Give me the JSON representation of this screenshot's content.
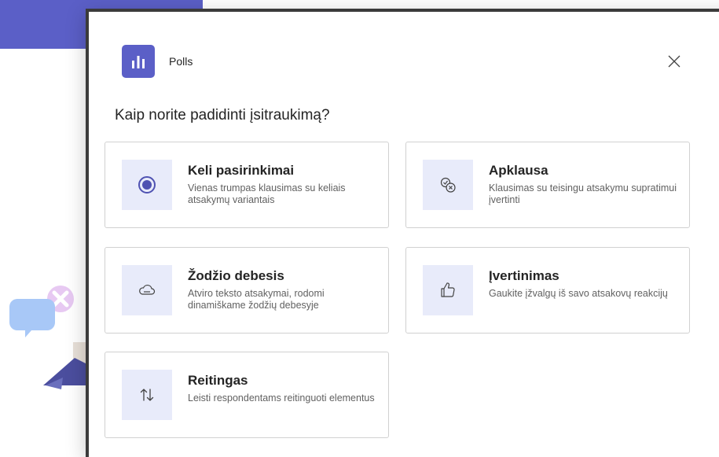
{
  "app": {
    "name": "Polls",
    "icon": "bar-chart-icon",
    "accent": "#5b5fc7"
  },
  "close": {
    "icon": "close-icon"
  },
  "question": "Kaip norite padidinti įsitraukimą?",
  "options": [
    {
      "title": "Keli pasirinkimai",
      "description": "Vienas trumpas klausimas su keliais atsakymų variantais",
      "icon": "radio-button-icon"
    },
    {
      "title": "Apklausa",
      "description": "Klausimas su teisingu atsakymu supratimui įvertinti",
      "icon": "quiz-check-icon"
    },
    {
      "title": "Žodžio debesis",
      "description": "Atviro teksto atsakymai, rodomi dinamiškame žodžių debesyje",
      "icon": "cloud-icon"
    },
    {
      "title": "Įvertinimas",
      "description": "Gaukite įžvalgų iš savo atsakovų reakcijų",
      "icon": "thumbs-up-icon"
    },
    {
      "title": "Reitingas",
      "description": "Leisti respondentams reitinguoti elementus",
      "icon": "sort-arrows-icon"
    }
  ],
  "colors": {
    "card_border": "#d1d1d1",
    "icon_tile": "#e8ebfa",
    "text": "#242424",
    "subtext": "#616161"
  }
}
